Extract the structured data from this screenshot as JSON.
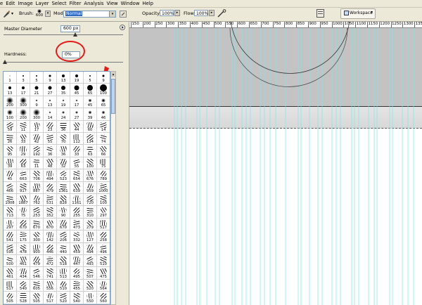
{
  "menu": [
    "e",
    "Edit",
    "Image",
    "Layer",
    "Select",
    "Filter",
    "Analysis",
    "View",
    "Window",
    "Help"
  ],
  "options": {
    "brush_label": "Brush:",
    "brush_size": "600",
    "mode_label": "Mode:",
    "mode_value": "Normal",
    "opacity_label": "Opacity:",
    "opacity_value": "100%",
    "flow_label": "Flow:",
    "flow_value": "100%",
    "workspace_label": "Workspace"
  },
  "brush_panel": {
    "master_diameter_label": "Master Diameter",
    "master_diameter_value": "600 px",
    "master_diameter_fraction": 0.6,
    "hardness_label": "Hardness:",
    "hardness_value": "0%",
    "hardness_fraction": 0.0
  },
  "brush_presets": [
    [
      "1",
      "3",
      "5",
      "9",
      "13",
      "19",
      "5",
      "9"
    ],
    [
      "13",
      "17",
      "21",
      "27",
      "35",
      "45",
      "65",
      "100"
    ],
    [
      "200",
      "300",
      "9",
      "13",
      "19",
      "17",
      "45",
      "65"
    ],
    [
      "100",
      "200",
      "300",
      "14",
      "24",
      "27",
      "39",
      "46"
    ],
    [
      "59",
      "11",
      "17",
      "23",
      "36",
      "44",
      "60",
      "14"
    ],
    [
      "26",
      "33",
      "42",
      "55",
      "70",
      "112",
      "134",
      "74"
    ],
    [
      "95",
      "29",
      "192",
      "36",
      "36",
      "33",
      "63",
      "66"
    ],
    [
      "39",
      "63",
      "11",
      "48",
      "32",
      "55",
      "100",
      "75"
    ],
    [
      "45",
      "663",
      "706",
      "494",
      "523",
      "654",
      "676",
      "789"
    ],
    [
      "466",
      "917",
      "887",
      "479",
      "1361",
      "639",
      "959",
      "1000"
    ],
    [
      "1008",
      "1887",
      "762",
      "531",
      "828",
      "1161",
      "720",
      "100"
    ],
    [
      "713",
      "75",
      "253",
      "352",
      "90",
      "255",
      "310",
      "297"
    ],
    [
      "297",
      "670",
      "670",
      "670",
      "670",
      "473",
      "279",
      "517"
    ],
    [
      "541",
      "175",
      "300",
      "142",
      "206",
      "332",
      "127",
      "258"
    ],
    [
      "595",
      "478",
      "900",
      "446",
      "440",
      "459",
      "494",
      "496"
    ],
    [
      "500",
      "461",
      "479",
      "472",
      "518",
      "447",
      "493",
      "510"
    ],
    [
      "461",
      "434",
      "546",
      "741",
      "513",
      "495",
      "507",
      "475"
    ],
    [
      "517",
      "540",
      "605",
      "556",
      "510",
      "455",
      "520",
      "564"
    ],
    [
      "505",
      "528",
      "505",
      "517",
      "520",
      "540",
      "550",
      "560"
    ]
  ],
  "ruler_labels": [
    "150",
    "200",
    "250",
    "300",
    "350",
    "400",
    "450",
    "500",
    "550",
    "600",
    "650",
    "700",
    "750",
    "800",
    "850",
    "900",
    "950",
    "1000",
    "1050",
    "1100",
    "1150",
    "1200",
    "1250",
    "1300",
    "1350"
  ],
  "colors": {
    "annotation_red": "#e21a1a",
    "guide_cyan": "#7fe6ec",
    "ui_beige": "#ece9d8"
  }
}
